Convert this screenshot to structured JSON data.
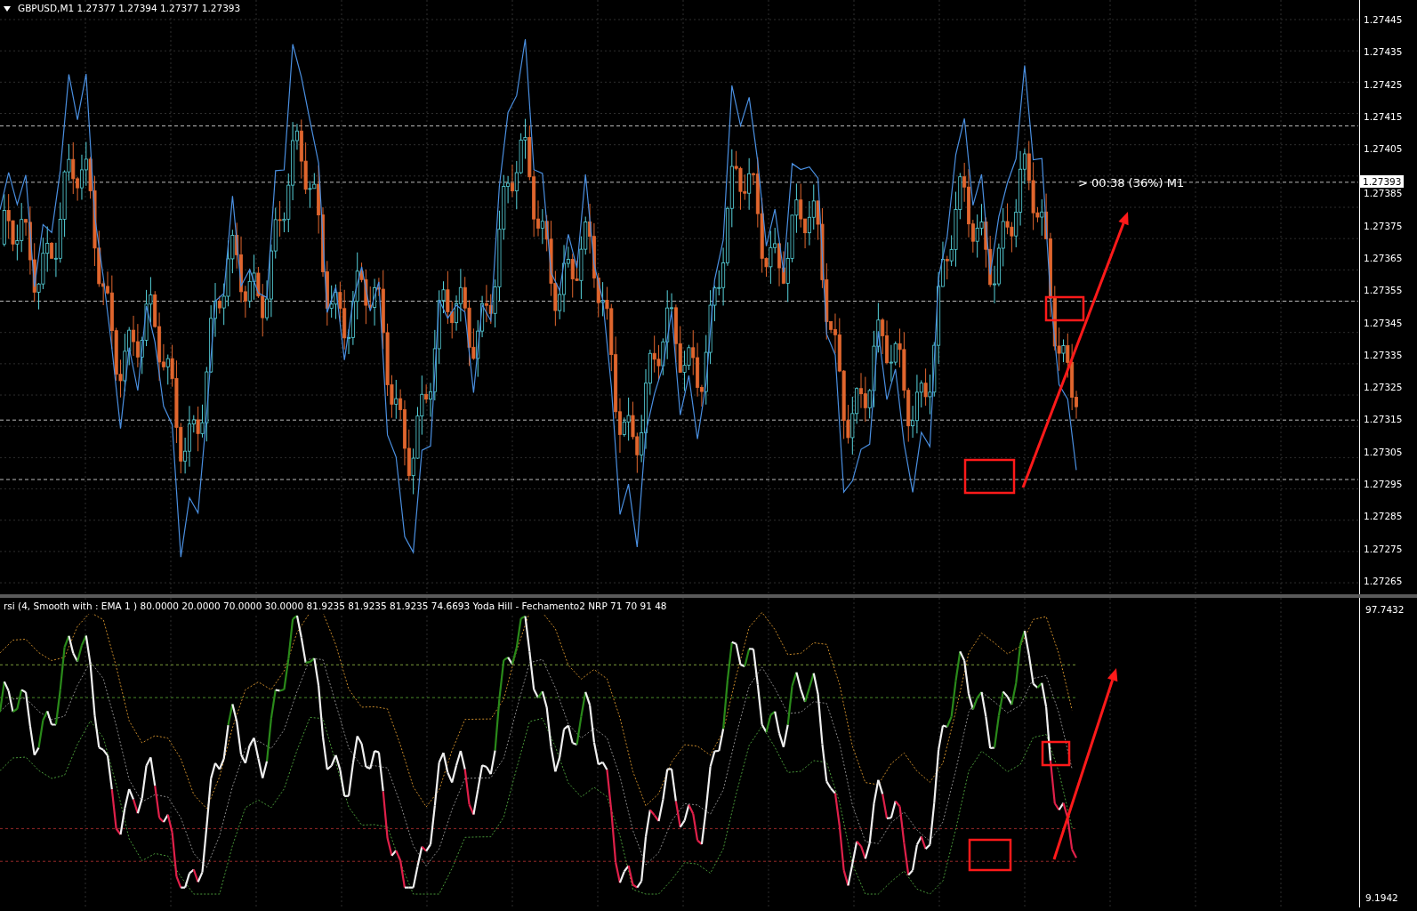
{
  "price_chart": {
    "symbol": "GBPUSD,M1",
    "ohlc": [
      "1.27377",
      "1.27394",
      "1.27377",
      "1.27393"
    ],
    "timer": "> 00:38 (36%) M1",
    "current_price": "1.27393",
    "axis_labels": [
      "1.27445",
      "1.27435",
      "1.27425",
      "1.27415",
      "1.27405",
      "1.27385",
      "1.27375",
      "1.27365",
      "1.27355",
      "1.27345",
      "1.27335",
      "1.27325",
      "1.27315",
      "1.27305",
      "1.27295",
      "1.27285",
      "1.27275",
      "1.27265"
    ]
  },
  "indicator": {
    "title": "rsi (4, Smooth with : EMA  1 ) 80.0000 20.0000 70.0000 30.0000 81.9235 81.9235 81.9235 74.6693  Yoda Hill - Fechamento2 NRP 71 70 91 48",
    "axis_max": "97.7432",
    "axis_min": "9.1942"
  }
}
